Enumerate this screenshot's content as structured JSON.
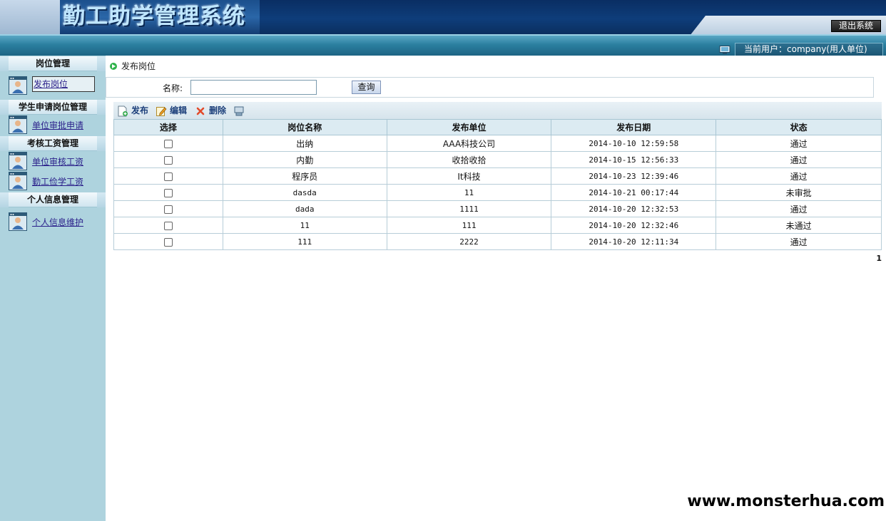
{
  "header": {
    "title": "勤工助学管理系统",
    "logout_label": "退出系统",
    "current_user": "当前用户：company(用人单位)"
  },
  "sidebar": {
    "sections": [
      {
        "title": "岗位管理",
        "items": [
          "发布岗位"
        ]
      },
      {
        "title": "学生申请岗位管理",
        "items": [
          "单位审批申请"
        ]
      },
      {
        "title": "考核工资管理",
        "items": [
          "单位审核工资",
          "勤工俭学工资"
        ]
      },
      {
        "title": "个人信息管理",
        "items": [
          "个人信息维护"
        ]
      }
    ]
  },
  "main": {
    "breadcrumb": "发布岗位",
    "search": {
      "label": "名称:",
      "value": "",
      "button": "查询"
    },
    "toolbar": {
      "publish": "发布",
      "edit": "编辑",
      "delete": "删除"
    },
    "table": {
      "headers": [
        "选择",
        "岗位名称",
        "发布单位",
        "发布日期",
        "状态"
      ],
      "rows": [
        [
          "出纳",
          "AAA科技公司",
          "2014-10-10 12:59:58",
          "通过"
        ],
        [
          "内勤",
          "收拾收拾",
          "2014-10-15 12:56:33",
          "通过"
        ],
        [
          "程序员",
          "It科技",
          "2014-10-23 12:39:46",
          "通过"
        ],
        [
          "dasda",
          "11",
          "2014-10-21 00:17:44",
          "未审批"
        ],
        [
          "dada",
          "1111",
          "2014-10-20 12:32:53",
          "通过"
        ],
        [
          "11",
          "111",
          "2014-10-20 12:32:46",
          "未通过"
        ],
        [
          "111",
          "2222",
          "2014-10-20 12:11:34",
          "通过"
        ]
      ]
    },
    "pager": "1"
  },
  "watermark": "www.monsterhua.com",
  "colors": {
    "sidebar_bg": "#aed3de",
    "header_bg": "#0e3d7a",
    "link": "#2a1f8a",
    "toolbar_text": "#1c3f7a"
  }
}
